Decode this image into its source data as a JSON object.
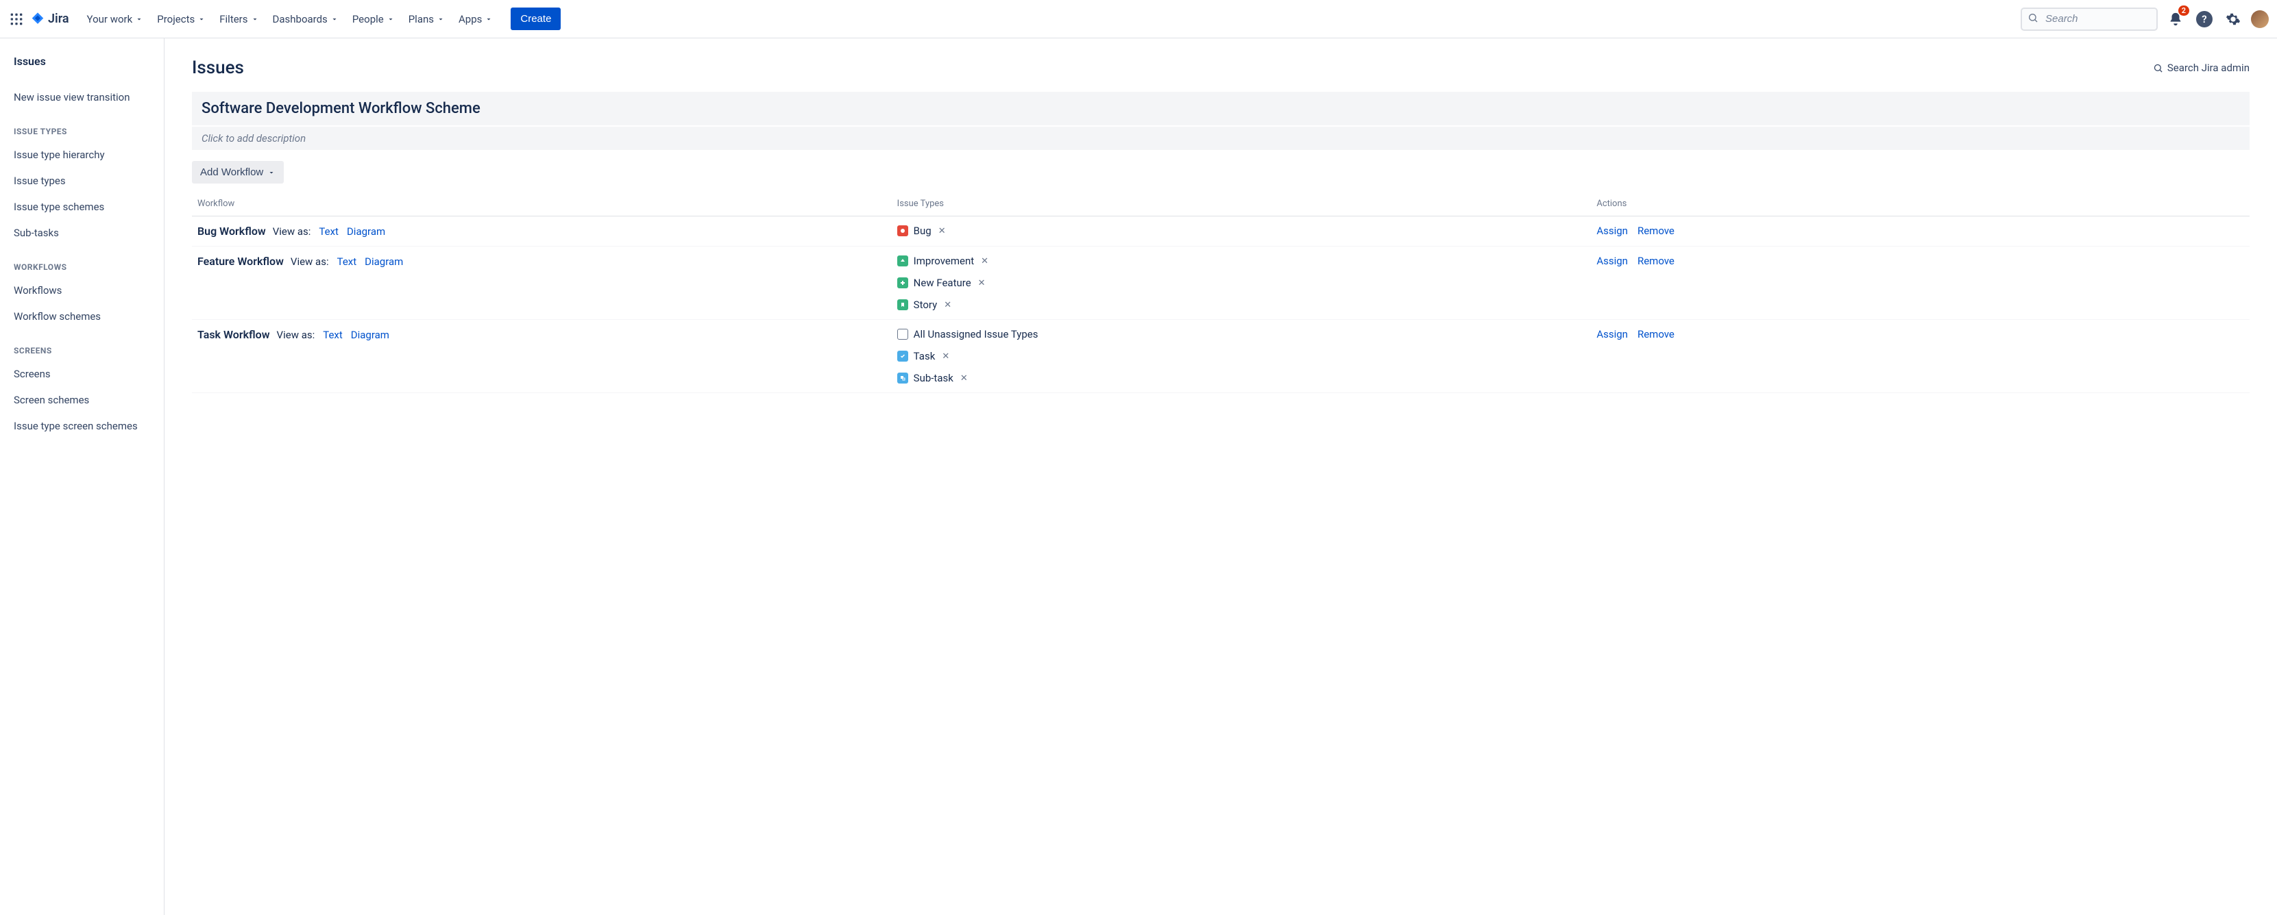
{
  "topnav": {
    "product": "Jira",
    "items": [
      "Your work",
      "Projects",
      "Filters",
      "Dashboards",
      "People",
      "Plans",
      "Apps"
    ],
    "create": "Create",
    "search_placeholder": "Search",
    "notif_count": "2"
  },
  "sidebar": {
    "title": "Issues",
    "top_links": [
      "New issue view transition"
    ],
    "groups": [
      {
        "heading": "ISSUE TYPES",
        "links": [
          "Issue type hierarchy",
          "Issue types",
          "Issue type schemes",
          "Sub-tasks"
        ]
      },
      {
        "heading": "WORKFLOWS",
        "links": [
          "Workflows",
          "Workflow schemes"
        ]
      },
      {
        "heading": "SCREENS",
        "links": [
          "Screens",
          "Screen schemes",
          "Issue type screen schemes"
        ]
      }
    ]
  },
  "page": {
    "title": "Issues",
    "admin_search": "Search Jira admin",
    "scheme_name": "Software Development Workflow Scheme",
    "description_placeholder": "Click to add description",
    "add_workflow": "Add Workflow",
    "columns": {
      "workflow": "Workflow",
      "issue_types": "Issue Types",
      "actions": "Actions"
    },
    "view_as_label": "View as:",
    "text_label": "Text",
    "diagram_label": "Diagram",
    "assign_label": "Assign",
    "remove_label": "Remove",
    "rows": [
      {
        "name": "Bug Workflow",
        "issue_types": [
          {
            "name": "Bug",
            "icon": "bug",
            "removable": true
          }
        ]
      },
      {
        "name": "Feature Workflow",
        "issue_types": [
          {
            "name": "Improvement",
            "icon": "improvement",
            "removable": true
          },
          {
            "name": "New Feature",
            "icon": "newfeature",
            "removable": true
          },
          {
            "name": "Story",
            "icon": "story",
            "removable": true
          }
        ]
      },
      {
        "name": "Task Workflow",
        "issue_types": [
          {
            "name": "All Unassigned Issue Types",
            "icon": "unassigned",
            "removable": false
          },
          {
            "name": "Task",
            "icon": "task",
            "removable": true
          },
          {
            "name": "Sub-task",
            "icon": "subtask",
            "removable": true
          }
        ]
      }
    ]
  }
}
